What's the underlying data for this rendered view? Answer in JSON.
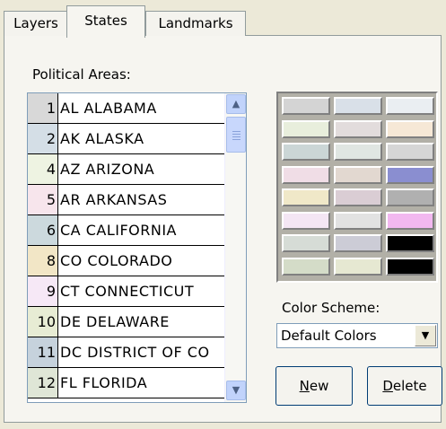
{
  "tabs": [
    {
      "label": "Layers",
      "active": false
    },
    {
      "label": "States",
      "active": true
    },
    {
      "label": "Landmarks",
      "active": false
    }
  ],
  "political_areas_label": "Political Areas:",
  "states": [
    {
      "num": "1",
      "name": "AL  ALABAMA",
      "color": "#d8d8d8"
    },
    {
      "num": "2",
      "name": "AK  ALASKA",
      "color": "#d4dee6"
    },
    {
      "num": "4",
      "name": "AZ  ARIZONA",
      "color": "#eef3e2"
    },
    {
      "num": "5",
      "name": "AR  ARKANSAS",
      "color": "#f7e5ec"
    },
    {
      "num": "6",
      "name": "CA  CALIFORNIA",
      "color": "#ccd9dd"
    },
    {
      "num": "8",
      "name": "CO  COLORADO",
      "color": "#f2e6c6"
    },
    {
      "num": "9",
      "name": "CT  CONNECTICUT",
      "color": "#f6e8f6"
    },
    {
      "num": "10",
      "name": "DE  DELAWARE",
      "color": "#e7ecd4"
    },
    {
      "num": "11",
      "name": "DC  DISTRICT OF CO",
      "color": "#c6d2dc"
    },
    {
      "num": "12",
      "name": "FL  FLORIDA",
      "color": "#dfe6d6"
    }
  ],
  "swatches": [
    "#d4d4d4",
    "#d9e0e8",
    "#eaeef2",
    "#e8eedc",
    "#e2dcdc",
    "#f6e8d6",
    "#cbd6d6",
    "#e0e6e2",
    "#d6d6d6",
    "#f0dde6",
    "#e2d8d0",
    "#8a8ed0",
    "#f0e8c8",
    "#dacdd4",
    "#b0b0b0",
    "#f4e6f4",
    "#e2e2e2",
    "#f2b8f0",
    "#d6dcd6",
    "#ccccd6",
    "#000000",
    "#d4dcc8",
    "#e6e8d2",
    "#000000"
  ],
  "color_scheme_label": "Color Scheme:",
  "color_scheme_value": "Default Colors",
  "new_button": {
    "pre": "",
    "mn": "N",
    "post": "ew"
  },
  "delete_button": {
    "pre": "",
    "mn": "D",
    "post": "elete"
  }
}
